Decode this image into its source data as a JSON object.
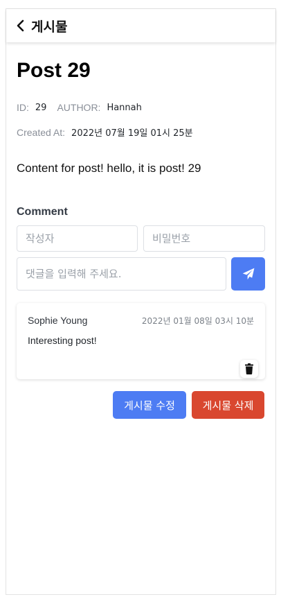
{
  "header": {
    "title": "게시물"
  },
  "post": {
    "title": "Post 29",
    "id_label": "ID:",
    "id_value": "29",
    "author_label": "AUTHOR:",
    "author_value": "Hannah",
    "created_label": "Created At:",
    "created_value": "2022년 07월 19일 01시 25분",
    "content": "Content for post! hello, it is post! 29"
  },
  "comment_form": {
    "heading": "Comment",
    "author_placeholder": "작성자",
    "password_placeholder": "비밀번호",
    "content_placeholder": "댓글을 입력해 주세요."
  },
  "comments": [
    {
      "author": "Sophie Young",
      "date": "2022년 01월 08일 03시 10분",
      "text": "Interesting post!"
    }
  ],
  "actions": {
    "edit_label": "게시물 수정",
    "delete_label": "게시물 삭제"
  },
  "colors": {
    "primary": "#4d7cf3",
    "danger": "#d9472f"
  },
  "icons": {
    "back": "chevron-left-icon",
    "send": "paper-plane-icon",
    "delete": "trash-icon"
  }
}
